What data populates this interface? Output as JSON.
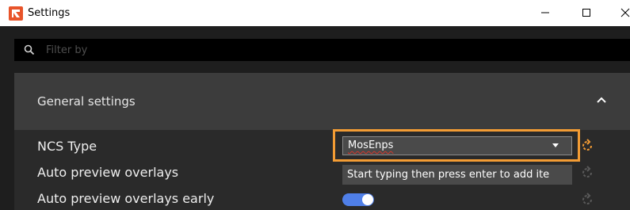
{
  "window": {
    "title": "Settings",
    "app_icon": "app-logo-icon",
    "controls": [
      "minimize-icon",
      "maximize-icon",
      "close-icon"
    ]
  },
  "filter": {
    "placeholder": "Filter by",
    "value": "",
    "icon": "search-icon"
  },
  "section": {
    "title": "General settings",
    "chevron": "chevron-up-icon"
  },
  "settings": [
    {
      "label": "NCS Type",
      "control": "select",
      "value": "MosEnps",
      "reset_icon": "reset-icon",
      "reset_active": true,
      "highlighted": true
    },
    {
      "label": "Auto preview overlays",
      "control": "tag-input",
      "placeholder": "Start typing then press enter to add ite",
      "reset_icon": "reset-icon",
      "reset_active": false
    },
    {
      "label": "Auto preview overlays early",
      "control": "toggle",
      "value": true,
      "reset_icon": "reset-icon",
      "reset_active": false
    }
  ],
  "colors": {
    "highlight": "#f39c34",
    "reset_active": "#f39c34",
    "reset_inactive": "#5a5a5a",
    "toggle_on": "#4f7fe8",
    "app_logo": "#e8542a"
  }
}
